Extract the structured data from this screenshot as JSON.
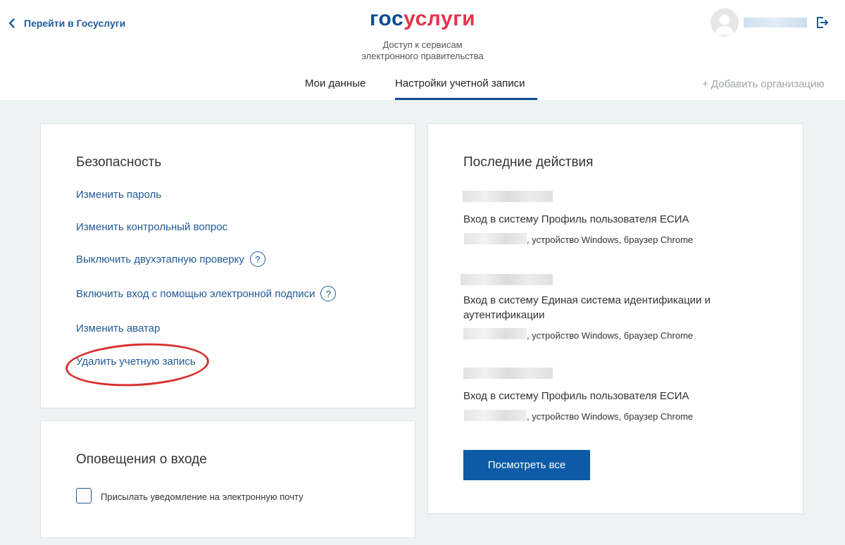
{
  "header": {
    "back_label": "Перейти в Госуслуги",
    "logo_part1": "гос",
    "logo_part2": "услуги",
    "tagline_line1": "Доступ к сервисам",
    "tagline_line2": "электронного правительства",
    "tabs": [
      {
        "label": "Мои данные",
        "active": false
      },
      {
        "label": "Настройки учетной записи",
        "active": true
      }
    ],
    "add_org": "+ Добавить организацию",
    "accent_color": "#0d4c8f",
    "logo_red": "#e3354b"
  },
  "security": {
    "title": "Безопасность",
    "links": [
      {
        "label": "Изменить пароль",
        "help": false
      },
      {
        "label": "Изменить контрольный вопрос",
        "help": false
      },
      {
        "label": "Выключить двухэтапную проверку",
        "help": true
      },
      {
        "label": "Включить вход с помощью электронной подписи",
        "help": true
      },
      {
        "label": "Изменить аватар",
        "help": false
      },
      {
        "label": "Удалить учетную запись",
        "help": false,
        "highlighted": true
      }
    ],
    "help_glyph": "?"
  },
  "alerts": {
    "title": "Оповещения о входе",
    "checkbox_label": "Присылать уведомление на электронную почту",
    "checked": false
  },
  "recent": {
    "title": "Последние действия",
    "items": [
      {
        "title": "Вход в систему Профиль пользователя ЕСИА",
        "device": ", устройство Windows, браузер Chrome"
      },
      {
        "title": "Вход в систему Единая система идентификации и аутентификации",
        "device": ", устройство Windows, браузер Chrome"
      },
      {
        "title": "Вход в систему Профиль пользователя ЕСИА",
        "device": ", устройство Windows, браузер Chrome"
      }
    ],
    "button_label": "Посмотреть все",
    "button_color": "#0d5ba8"
  }
}
